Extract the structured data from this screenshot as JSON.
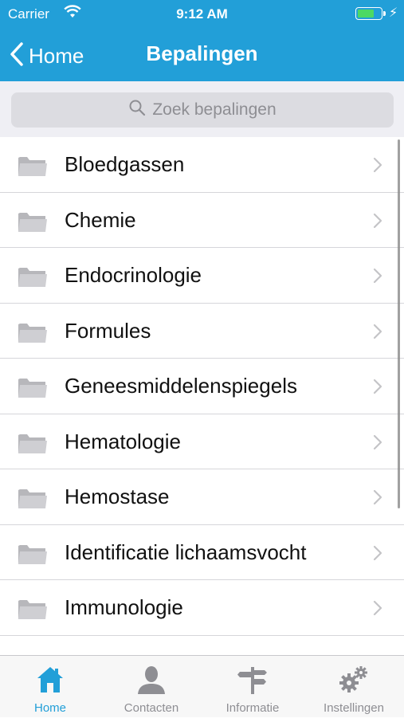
{
  "status_bar": {
    "carrier": "Carrier",
    "time": "9:12 AM",
    "battery_level": 0.75,
    "battery_color": "#4cd964"
  },
  "nav": {
    "back_label": "Home",
    "back_icon": "chevron-left-icon",
    "title": "Bepalingen",
    "bar_color": "#229fd8"
  },
  "search": {
    "placeholder": "Zoek bepalingen",
    "icon": "search-icon"
  },
  "list": {
    "item_icon": "folder-icon",
    "accessory_icon": "chevron-right-icon",
    "items": [
      {
        "label": "Bloedgassen"
      },
      {
        "label": "Chemie"
      },
      {
        "label": "Endocrinologie"
      },
      {
        "label": "Formules"
      },
      {
        "label": "Geneesmiddelenspiegels"
      },
      {
        "label": "Hematologie"
      },
      {
        "label": "Hemostase"
      },
      {
        "label": "Identificatie lichaamsvocht"
      },
      {
        "label": "Immunologie"
      },
      {
        "label": ""
      }
    ]
  },
  "tabbar": {
    "active_color": "#229fd8",
    "tabs": [
      {
        "label": "Home",
        "icon": "home-icon",
        "active": true
      },
      {
        "label": "Contacten",
        "icon": "person-icon",
        "active": false
      },
      {
        "label": "Informatie",
        "icon": "signpost-icon",
        "active": false
      },
      {
        "label": "Instellingen",
        "icon": "gears-icon",
        "active": false
      }
    ]
  }
}
